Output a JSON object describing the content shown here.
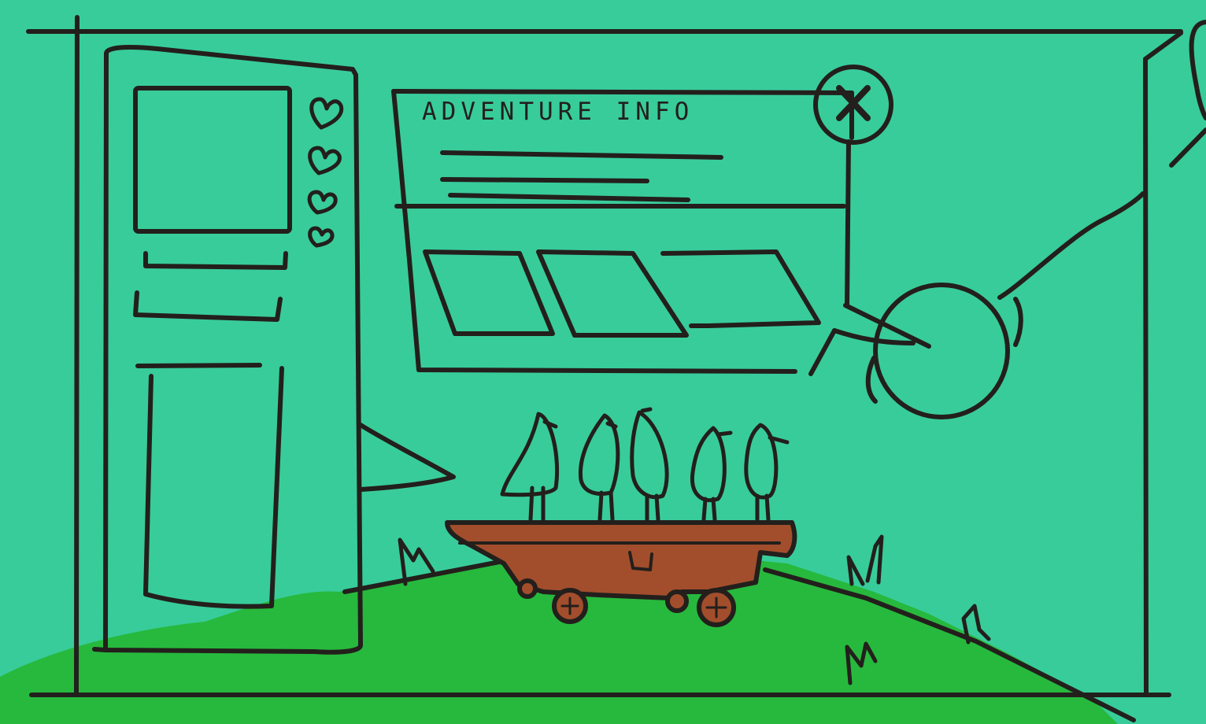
{
  "info_panel": {
    "title": "ADVENTURE INFO",
    "close_icon": "close-x-icon"
  },
  "side_panel": {
    "lives_icon": "heart-icon",
    "lives_count": 4
  },
  "colors": {
    "background": "#38cc9b",
    "grass": "#27b93d",
    "cart": "#a24e2c",
    "ink": "#231f1c"
  }
}
